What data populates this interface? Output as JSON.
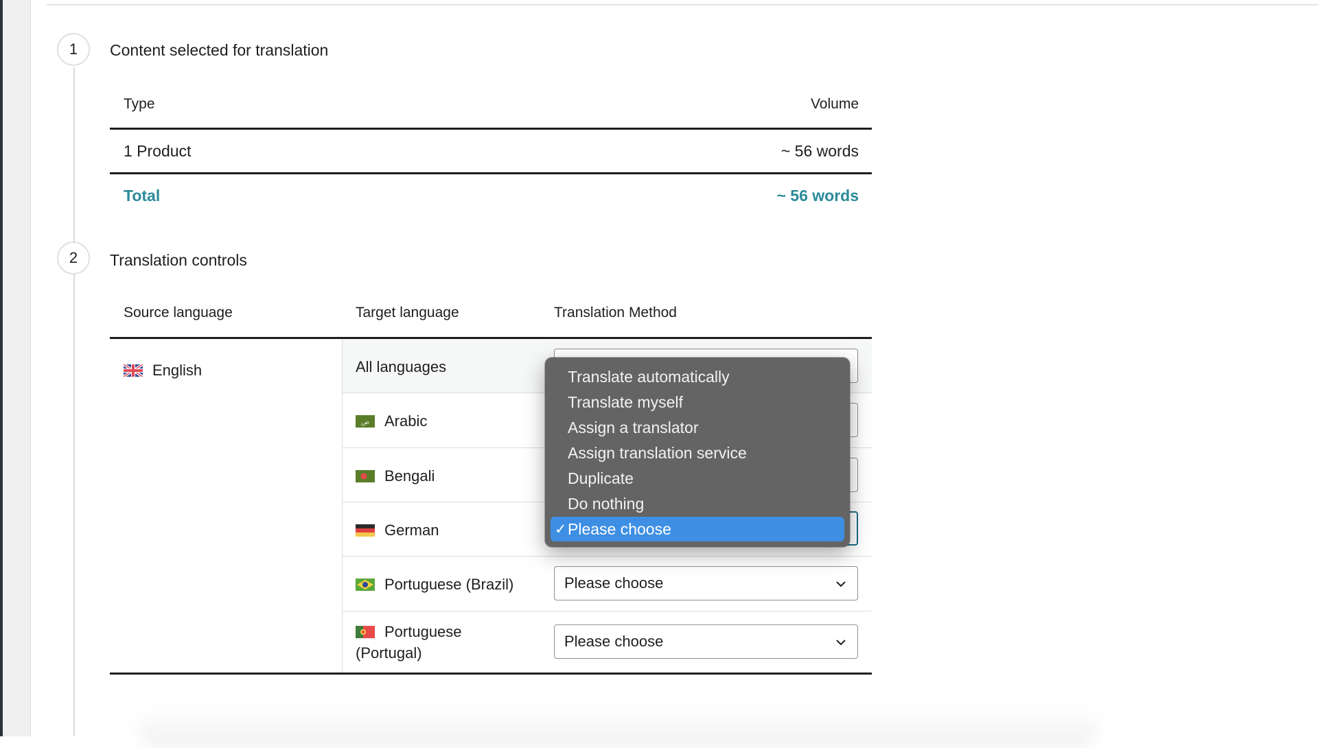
{
  "steps": [
    {
      "number": "1",
      "title": "Content selected for translation"
    },
    {
      "number": "2",
      "title": "Translation controls"
    }
  ],
  "content_table": {
    "headers": {
      "type": "Type",
      "volume": "Volume"
    },
    "rows": [
      {
        "type": "1 Product",
        "volume": "~ 56 words"
      }
    ],
    "total": {
      "label": "Total",
      "volume": "~ 56 words"
    }
  },
  "controls_table": {
    "headers": {
      "source": "Source language",
      "target": "Target language",
      "method": "Translation Method"
    },
    "source_language": {
      "label": "English",
      "flag": "uk-flag"
    },
    "all_languages_label": "All languages",
    "targets": [
      {
        "label": "Arabic",
        "flag": "arabic-flag",
        "method": "Please choose"
      },
      {
        "label": "Bengali",
        "flag": "bangladesh-flag",
        "method": "Please choose"
      },
      {
        "label": "German",
        "flag": "germany-flag",
        "method": "Please choose"
      },
      {
        "label": "Portuguese (Brazil)",
        "flag": "brazil-flag",
        "method": "Please choose"
      },
      {
        "label_line1": "Portuguese",
        "label_line2": "(Portugal)",
        "flag": "portugal-flag",
        "method": "Please choose"
      }
    ]
  },
  "method_dropdown": {
    "open_for": "German",
    "options": [
      "Translate automatically",
      "Translate myself",
      "Assign a translator",
      "Assign translation service",
      "Duplicate",
      "Do nothing",
      "Please choose"
    ],
    "selected": "Please choose",
    "check_glyph": "✓"
  },
  "colors": {
    "accent_total": "#2b8a9a",
    "dropdown_bg": "#646464",
    "dropdown_selected": "#3e8fe4",
    "focus_border": "#1e6b8a"
  }
}
